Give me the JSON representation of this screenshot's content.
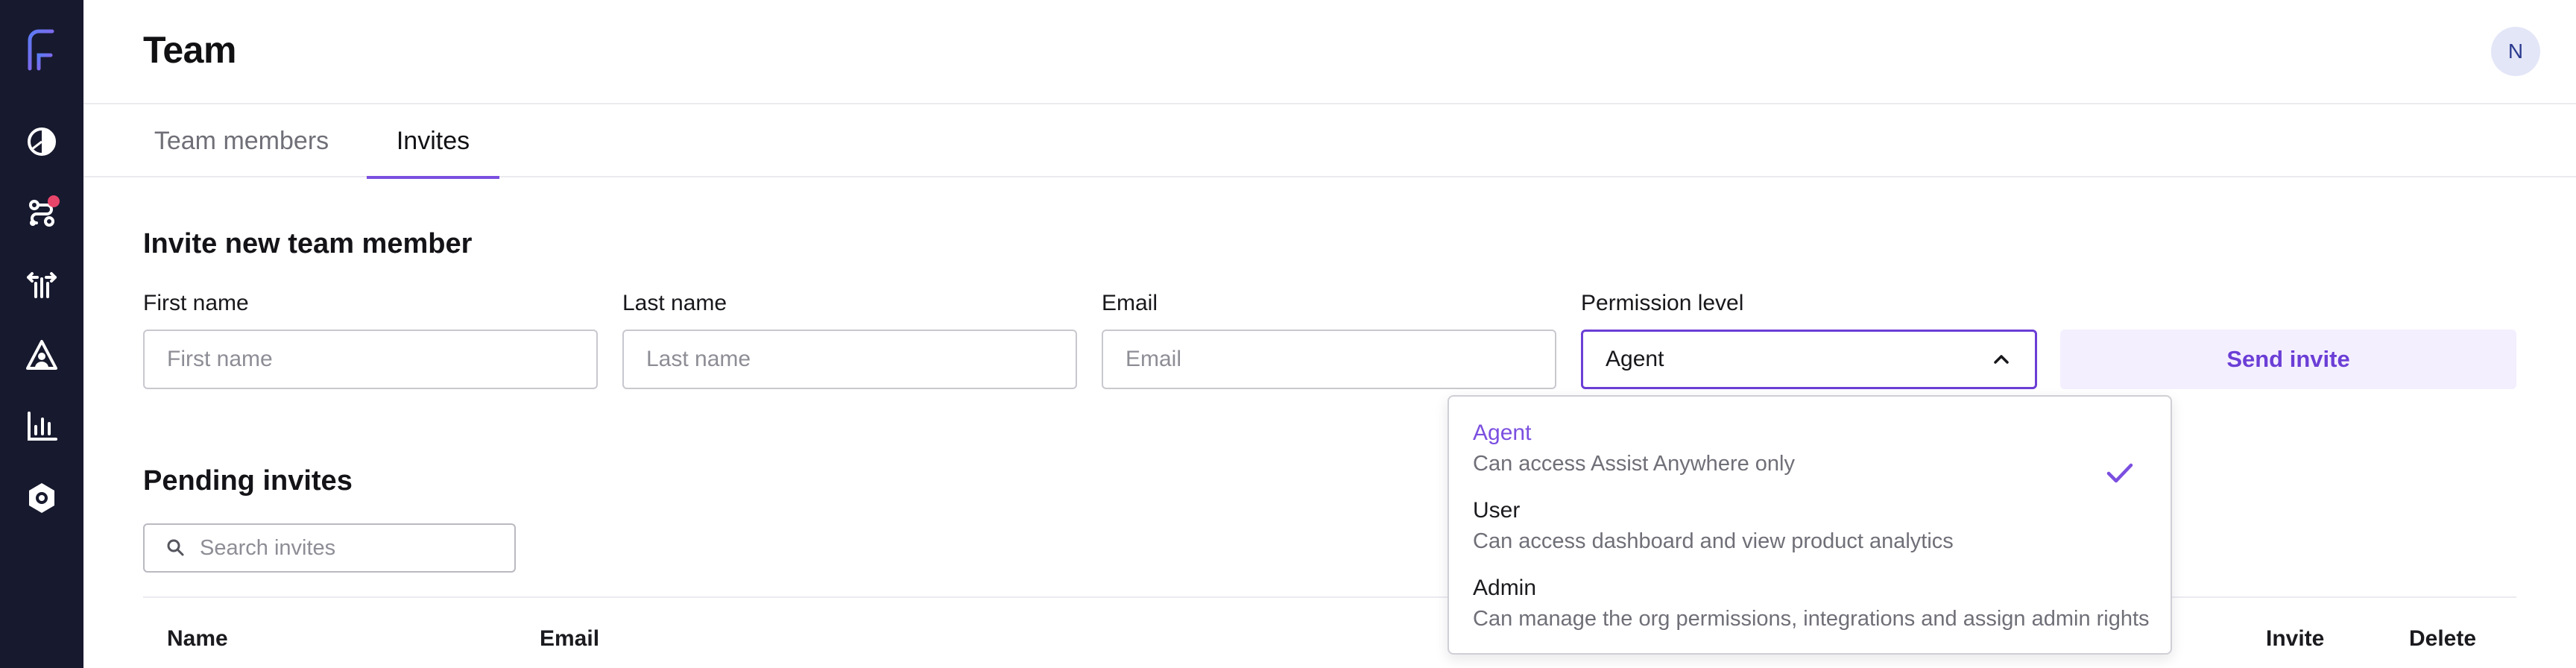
{
  "header": {
    "title": "Team",
    "avatar_initial": "N"
  },
  "tabs": [
    {
      "label": "Team members",
      "active": false
    },
    {
      "label": "Invites",
      "active": true
    }
  ],
  "invite": {
    "title": "Invite new team member",
    "first_name": {
      "label": "First name",
      "placeholder": "First name"
    },
    "last_name": {
      "label": "Last name",
      "placeholder": "Last name"
    },
    "email": {
      "label": "Email",
      "placeholder": "Email"
    },
    "permission": {
      "label": "Permission level",
      "value": "Agent"
    },
    "send_label": "Send invite"
  },
  "dropdown": {
    "options": [
      {
        "name": "Agent",
        "desc": "Can access Assist Anywhere only",
        "selected": true
      },
      {
        "name": "User",
        "desc": "Can access dashboard and view product analytics",
        "selected": false
      },
      {
        "name": "Admin",
        "desc": "Can manage the org permissions, integrations and assign admin rights",
        "selected": false
      }
    ]
  },
  "pending": {
    "title": "Pending invites",
    "search_placeholder": "Search invites",
    "columns": {
      "name": "Name",
      "email": "Email",
      "invite": "Invite",
      "delete": "Delete"
    }
  },
  "sidebar": {
    "icons": [
      "logo-icon",
      "dashboard-icon",
      "workflow-icon",
      "branch-icon",
      "assist-icon",
      "analytics-icon",
      "settings-icon"
    ],
    "notification_color": "#e8456b"
  },
  "colors": {
    "accent": "#7b4fe0",
    "rail_bg": "#17192e",
    "send_bg": "#f4efff"
  }
}
